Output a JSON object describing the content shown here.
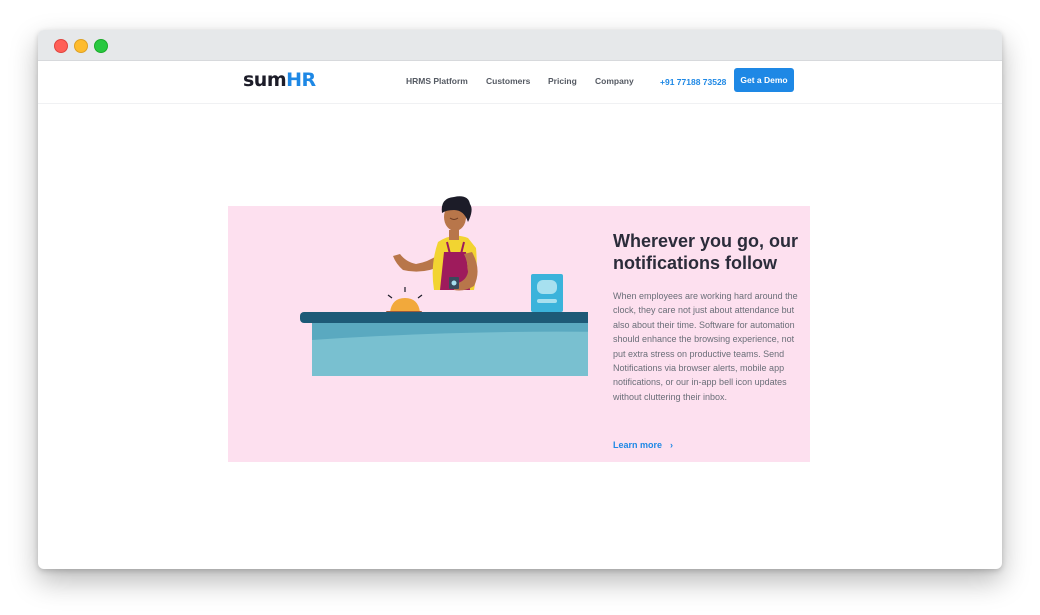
{
  "brand": {
    "logo_sum": "sum",
    "logo_hr": "HR",
    "primary_color": "#1e88e5"
  },
  "nav": {
    "links": [
      "HRMS Platform",
      "Customers",
      "Pricing",
      "Company"
    ],
    "phone": "+91 77188 73528",
    "cta": "Get a Demo"
  },
  "feature": {
    "background_color": "#fde0ef",
    "heading": "Wherever you go, our notifications follow",
    "description": "When employees are working hard around the clock, they care not just about attendance but also about their time. Software for automation should enhance the browsing experience, not put extra stress on productive teams. Send Notifications via browser alerts, mobile app notifications, or our in-app bell icon updates without cluttering their inbox.",
    "link_text": "Learn more",
    "link_icon": "chevron-right-icon"
  }
}
